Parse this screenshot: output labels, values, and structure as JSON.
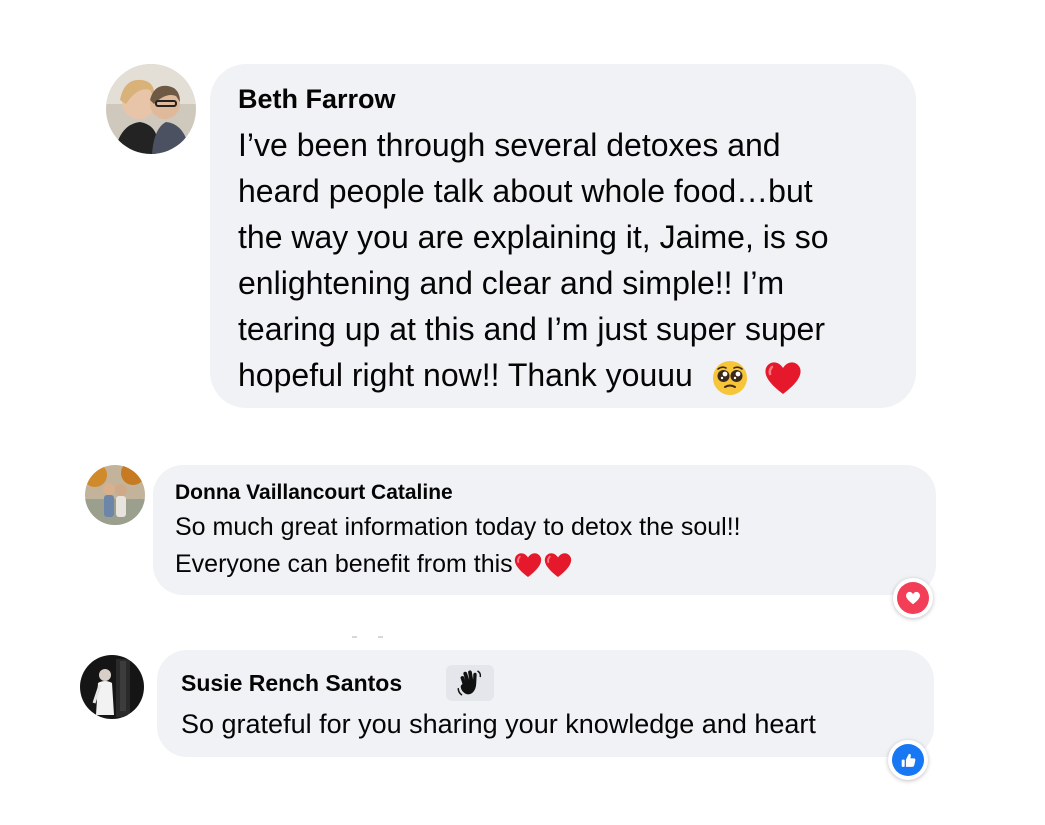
{
  "comments": [
    {
      "author": "Beth Farrow",
      "lines": [
        "I’ve been through several detoxes and",
        "heard people talk about whole food…but",
        "the way you are explaining it, Jaime, is so",
        "enlightening and clear and simple!! I’m",
        "tearing up at this and I’m just super super",
        "hopeful right now!! Thank youuu"
      ],
      "emojis": [
        "pleading-face-emoji",
        "red-heart-emoji"
      ]
    },
    {
      "author": "Donna Vaillancourt Cataline",
      "lines": [
        "So much great information today to detox the soul!!",
        "Everyone can benefit from this"
      ],
      "emojis": [
        "red-heart-emoji",
        "red-heart-emoji"
      ],
      "reaction": "love"
    },
    {
      "author": "Susie Rench Santos",
      "badge": "waving-hand-badge",
      "lines": [
        "So grateful for you sharing your knowledge and heart"
      ],
      "reaction": "like"
    }
  ],
  "colors": {
    "bubble": "#f0f2f5",
    "text": "#050505",
    "love": "#f33e58",
    "like": "#1877f2"
  }
}
